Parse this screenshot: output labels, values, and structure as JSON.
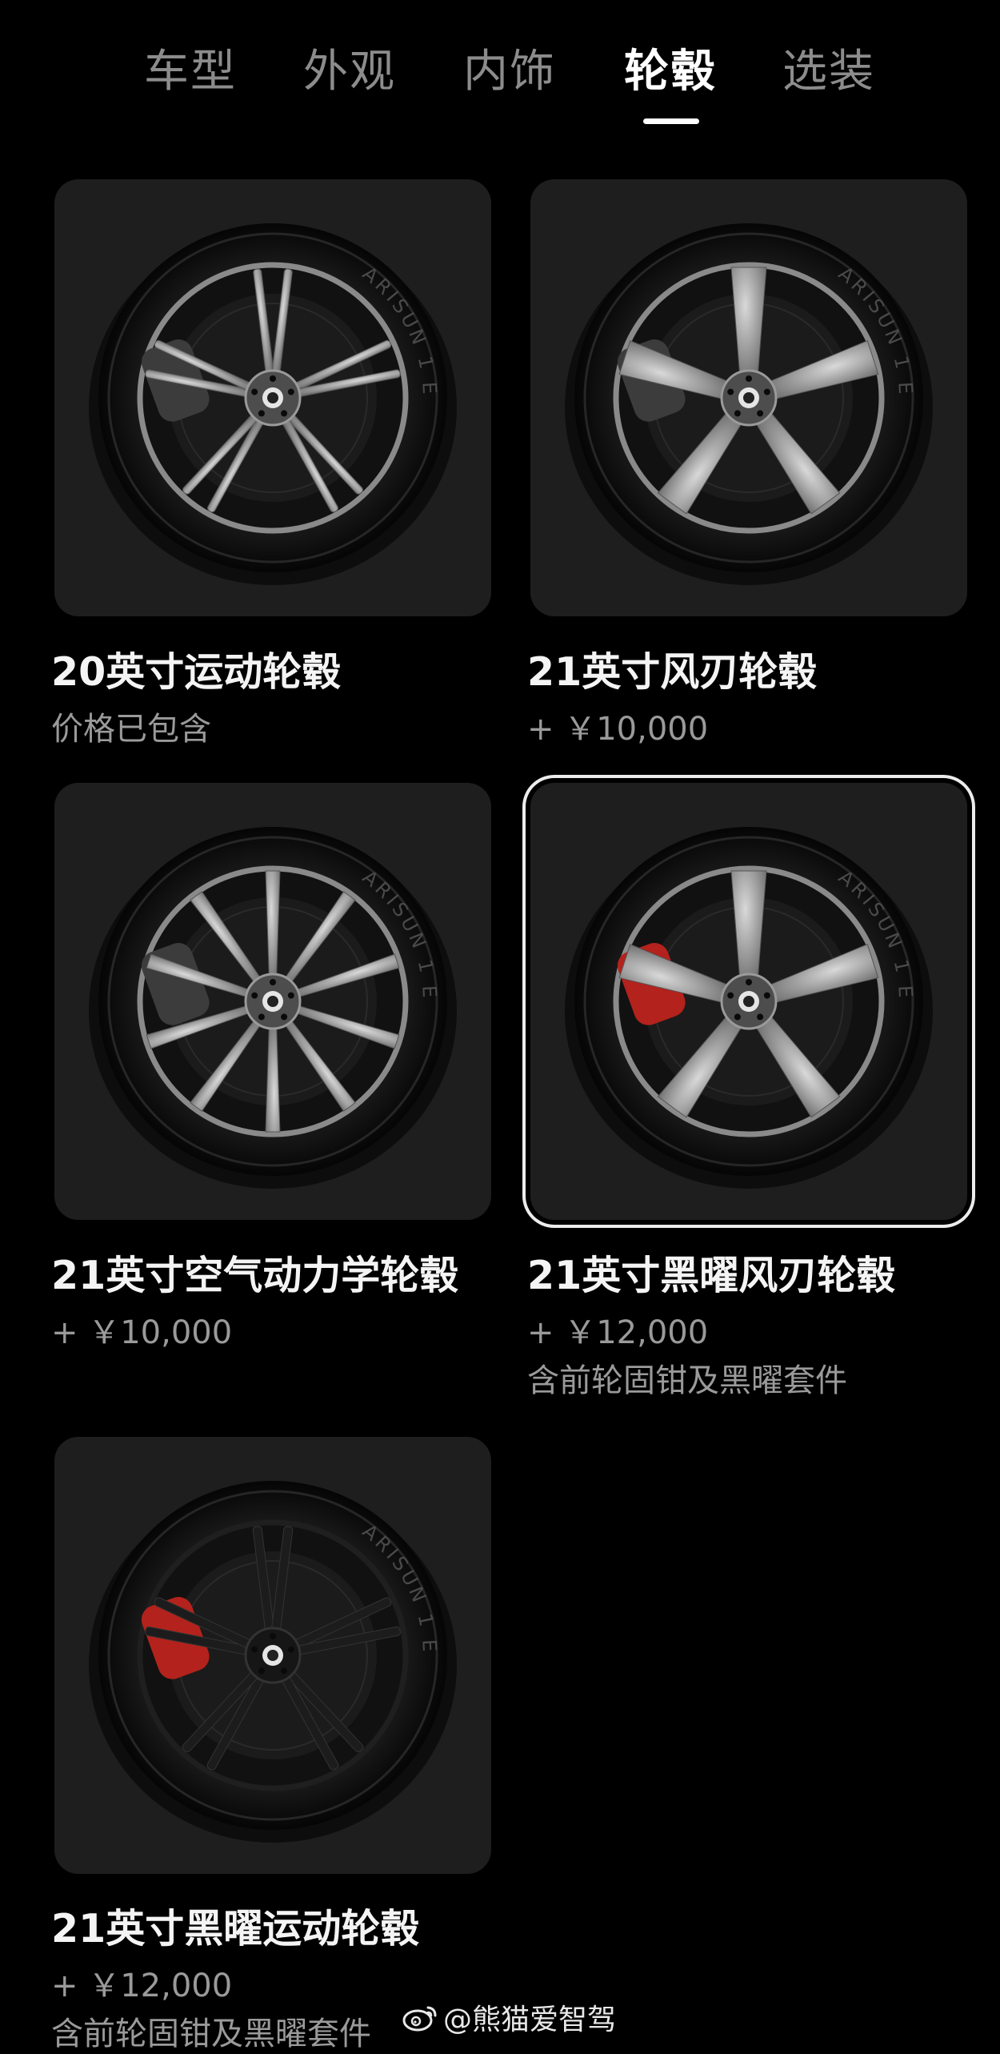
{
  "tabs": [
    {
      "label": "车型",
      "active": false
    },
    {
      "label": "外观",
      "active": false
    },
    {
      "label": "内饰",
      "active": false
    },
    {
      "label": "轮毂",
      "active": true
    },
    {
      "label": "选装",
      "active": false
    }
  ],
  "wheels": [
    {
      "name": "20英寸运动轮毂",
      "price": "价格已包含",
      "note": "",
      "selected": false,
      "tire_text": "ARISUN 1 EV",
      "caliper_color": "#3c3c3c"
    },
    {
      "name": "21英寸风刃轮毂",
      "price": "+ ￥10,000",
      "note": "",
      "selected": false,
      "tire_text": "ARISUN 1 EV",
      "caliper_color": "#3c3c3c"
    },
    {
      "name": "21英寸空气动力学轮毂",
      "price": "+ ￥10,000",
      "note": "",
      "selected": false,
      "tire_text": "ARISUN 1 EV",
      "caliper_color": "#3c3c3c"
    },
    {
      "name": "21英寸黑曜风刃轮毂",
      "price": "+ ￥12,000",
      "note": "含前轮固钳及黑曜套件",
      "selected": true,
      "tire_text": "ARISUN 1 EV",
      "caliper_color": "#b3221c"
    },
    {
      "name": "21英寸黑曜运动轮毂",
      "price": "+ ￥12,000",
      "note": "含前轮固钳及黑曜套件",
      "selected": false,
      "tire_text": "ARISUN 1 EV",
      "caliper_color": "#b3221c"
    }
  ],
  "watermark": "@熊猫爱智驾",
  "colors": {
    "background": "#000000",
    "card": "#1e1e1e",
    "tab_inactive": "#8c8c8c",
    "text_secondary": "#9a9a9a",
    "selected_border": "#ececec"
  }
}
